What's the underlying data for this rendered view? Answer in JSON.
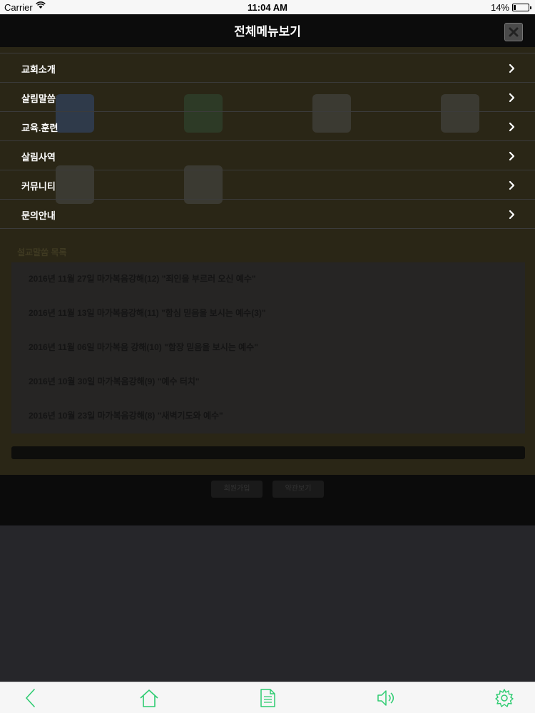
{
  "status_bar": {
    "carrier": "Carrier",
    "time": "11:04 AM",
    "battery": "14%",
    "battery_level": 0.14
  },
  "menu": {
    "title": "전체메뉴보기",
    "items": [
      {
        "label": "교회소개"
      },
      {
        "label": "살림말씀"
      },
      {
        "label": "교육.훈련"
      },
      {
        "label": "살림사역"
      },
      {
        "label": "커뮤니티"
      },
      {
        "label": "문의안내"
      }
    ]
  },
  "background": {
    "section_title": "설교말씀 목록",
    "sermons": [
      {
        "title": "2016년 11월 27일 마가복음강해(12) \"죄인을 부르러 오신 예수\""
      },
      {
        "title": "2016년 11월 13일 마가복음강해(11) \"함심 믿음을 보시는 예수(3)\""
      },
      {
        "title": "2016년 11월 06일 마가복음 강해(10) \"함장 믿음을 보시는 예수\""
      },
      {
        "title": "2016년 10월 30일 마가복음강해(9) \"예수 터치\""
      },
      {
        "title": "2016년 10월 23일 마가복음강해(8) \"새벽기도와 예수\""
      }
    ],
    "footer_buttons": [
      "회원가입",
      "약관보기"
    ]
  },
  "toolbar": {
    "icons": [
      "back-icon",
      "home-icon",
      "document-icon",
      "speaker-icon",
      "settings-icon"
    ],
    "accent": "#2ecc71"
  },
  "colors": {
    "overlay_bg": "#26262a",
    "menu_text": "#ffffff",
    "divider": "#3b3b3b"
  }
}
